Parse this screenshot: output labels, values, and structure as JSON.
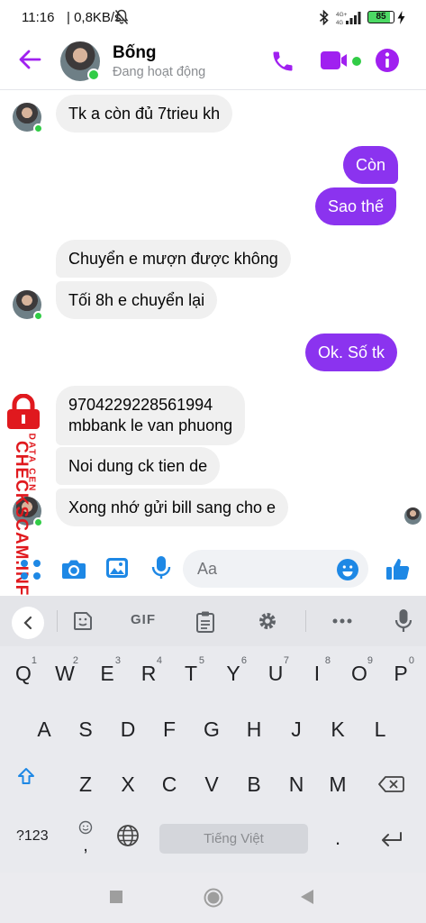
{
  "status_bar": {
    "time": "11:16",
    "network_speed": "| 0,8KB/s",
    "battery_level": "85",
    "icons": [
      "notifications-off-icon",
      "bluetooth-icon",
      "signal-4g-icon",
      "battery-icon",
      "charging-icon"
    ]
  },
  "header": {
    "contact_name": "Bống",
    "contact_status": "Đang hoạt động",
    "accent_color": "#a020f0",
    "icons": [
      "back-arrow-icon",
      "phone-icon",
      "video-camera-icon",
      "info-icon"
    ]
  },
  "messages": [
    {
      "direction": "in",
      "text": "Tk a còn đủ 7trieu kh"
    },
    {
      "direction": "out",
      "text": "Còn"
    },
    {
      "direction": "out",
      "text": "Sao thế"
    },
    {
      "direction": "in",
      "text": "Chuyển e mượn được không"
    },
    {
      "direction": "in",
      "text": "Tối 8h e chuyển lại"
    },
    {
      "direction": "out",
      "text": "Ok. Số tk"
    },
    {
      "direction": "in",
      "lines": [
        "9704229228561994",
        "mbbank le van phuong"
      ]
    },
    {
      "direction": "in",
      "text": "Noi dung ck tien de"
    },
    {
      "direction": "in",
      "text": "Xong nhớ gửi bill sang cho e"
    }
  ],
  "watermark": {
    "brand": "CHECKSCAM.INFO",
    "tagline": "DATA CEN",
    "color": "#e0191e"
  },
  "composer": {
    "placeholder": "Aa",
    "icons": [
      "menu-dots-icon",
      "camera-icon",
      "gallery-icon",
      "microphone-icon",
      "emoji-icon",
      "like-icon"
    ]
  },
  "keyboard": {
    "toolbar_icons": [
      "back-chevron-icon",
      "sticker-icon",
      "gif-icon",
      "clipboard-icon",
      "settings-icon",
      "more-icon",
      "voice-input-icon"
    ],
    "gif_label": "GIF",
    "row1": [
      {
        "key": "Q",
        "hint": "1"
      },
      {
        "key": "W",
        "hint": "2"
      },
      {
        "key": "E",
        "hint": "3"
      },
      {
        "key": "R",
        "hint": "4"
      },
      {
        "key": "T",
        "hint": "5"
      },
      {
        "key": "Y",
        "hint": "6"
      },
      {
        "key": "U",
        "hint": "7"
      },
      {
        "key": "I",
        "hint": "8"
      },
      {
        "key": "O",
        "hint": "9"
      },
      {
        "key": "P",
        "hint": "0"
      }
    ],
    "row2": [
      "A",
      "S",
      "D",
      "F",
      "G",
      "H",
      "J",
      "K",
      "L"
    ],
    "row3": [
      "Z",
      "X",
      "C",
      "V",
      "B",
      "N",
      "M"
    ],
    "symbols_label": "?123",
    "comma_label": ",",
    "space_label": "Tiếng Việt",
    "period_label": "."
  },
  "navigation": {
    "buttons": [
      "recents-icon",
      "home-icon",
      "back-icon"
    ]
  }
}
